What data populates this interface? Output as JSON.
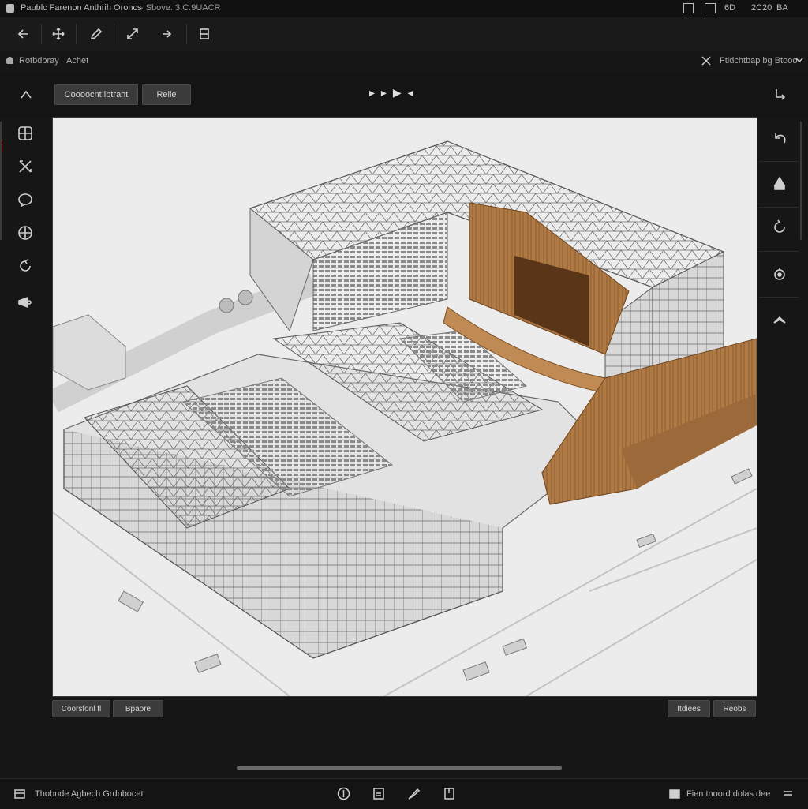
{
  "window": {
    "title": "Paublc Farenon Anthrih Oroncs",
    "version": "- Sbove. 3.C.9UACR",
    "status_right": [
      "6D",
      "2C20",
      "BA"
    ]
  },
  "toolbar": {
    "icons": [
      "back-arrow-icon",
      "move-icon",
      "pencil-icon",
      "resize-icon",
      "forward-arrow-icon",
      "frame-icon"
    ]
  },
  "breadcrumb": {
    "path": "Rotbdbray",
    "item": "Achet",
    "right_label": "Ftidchtbap bg Btooo"
  },
  "secondary": {
    "primary_button": "Coooocnt lbtrant",
    "secondary_button": "Reiie",
    "playback": "▸ ▸ ▶ ◂"
  },
  "left_sidebar": {
    "icons": [
      "grid-globe-icon",
      "tools-icon",
      "chat-icon",
      "grid-icon",
      "rotate-icon",
      "camera-icon"
    ]
  },
  "right_sidebar": {
    "icons": [
      "corner-arrow-icon",
      "undo-icon",
      "shapes-icon",
      "refresh-icon",
      "target-icon",
      "chevron-up-icon"
    ]
  },
  "viewport": {
    "description_hidden": true
  },
  "bottom_buttons": {
    "left": [
      "Coorsfonl fl",
      "Bpaore"
    ],
    "right": [
      "Itdiees",
      "Reobs"
    ]
  },
  "statusbar": {
    "left_label": "Thobnde Agbech Grdnbocet",
    "right_label": "Fien tnoord dolas dee",
    "center_icons": [
      "compass-icon",
      "file-icon",
      "brush-icon",
      "document-icon"
    ]
  },
  "colors": {
    "accent": "#c43b3b",
    "wood": "#b07a45",
    "background": "#161616",
    "viewport": "#ececec"
  }
}
